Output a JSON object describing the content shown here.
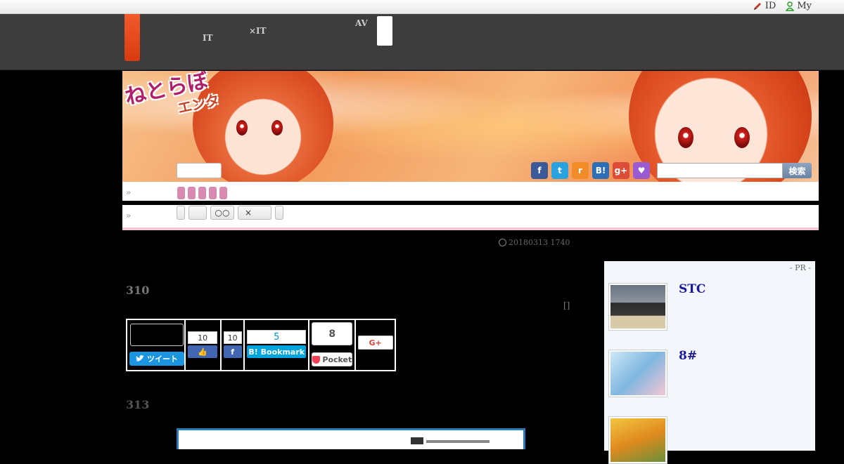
{
  "topbar": {
    "id_label": "ID",
    "my_label": "My"
  },
  "nav": {
    "item1_line1": "　　",
    "item1_line2": "IT",
    "item2_line1": "　　　",
    "item2_line2": "×IT",
    "item3_line1": "AV",
    "item3_line2": "　　"
  },
  "banner": {
    "logo_line1": "ねとらぼ",
    "logo_line2": "エンタ",
    "search_button": "検索"
  },
  "social_icons": [
    {
      "name": "facebook-icon",
      "glyph": "f",
      "color": "#3b5998"
    },
    {
      "name": "twitter-icon",
      "glyph": "t",
      "color": "#29a3e0"
    },
    {
      "name": "rss-icon",
      "glyph": "r",
      "color": "#f28c28"
    },
    {
      "name": "hatena-icon",
      "glyph": "B!",
      "color": "#2d6fb6"
    },
    {
      "name": "google-plus-icon",
      "glyph": "g+",
      "color": "#dd4b39"
    },
    {
      "name": "cat-icon",
      "glyph": "♥",
      "color": "#9a5bd0"
    }
  ],
  "breadcrumbs": {
    "arrow1": "»",
    "arrow2": "»"
  },
  "tags": [
    "",
    "",
    "○○",
    "×",
    ""
  ],
  "article": {
    "date": "20180313 1740",
    "title": "310",
    "bracket": "[]",
    "section": "313"
  },
  "share": {
    "tweet_label": "ツイート",
    "fb_like_count": "10",
    "fb_share_count": "10",
    "hatena_count": "5",
    "hatena_label": "Bookmark",
    "pocket_count": "8",
    "pocket_label": "Pocket",
    "gplus_label": "G+"
  },
  "sidebar": {
    "pr_label": "- PR -",
    "items": [
      {
        "title": "STC"
      },
      {
        "title": "8#"
      },
      {
        "title": ""
      }
    ]
  }
}
